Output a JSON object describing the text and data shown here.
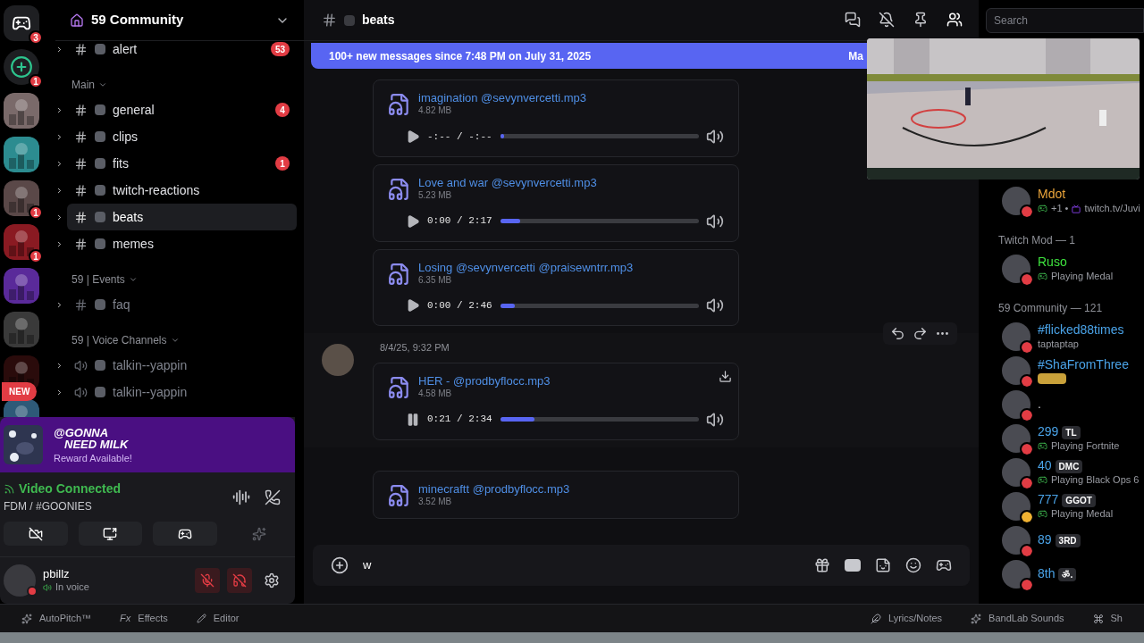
{
  "servers": [
    {
      "kind": "home",
      "badge": "3"
    },
    {
      "kind": "add",
      "badge": "1"
    },
    {
      "kind": "picture"
    },
    {
      "kind": "picture"
    },
    {
      "kind": "picture",
      "badge": "1"
    },
    {
      "kind": "picture",
      "badge": "1"
    },
    {
      "kind": "picture"
    },
    {
      "kind": "picture"
    },
    {
      "kind": "picture"
    },
    {
      "kind": "picture"
    }
  ],
  "new_pill": "NEW",
  "guild": {
    "name": "59 Community"
  },
  "channels": [
    {
      "kind": "text",
      "name": "alert",
      "badge": "53",
      "selected": false,
      "muted": false
    },
    {
      "kind": "category",
      "name": "Main"
    },
    {
      "kind": "text",
      "name": "general",
      "badge": "4",
      "selected": false,
      "muted": false
    },
    {
      "kind": "text",
      "name": "clips",
      "selected": false,
      "muted": false
    },
    {
      "kind": "text",
      "name": "fits",
      "badge": "1",
      "selected": false,
      "muted": false
    },
    {
      "kind": "text",
      "name": "twitch-reactions",
      "selected": false,
      "muted": false
    },
    {
      "kind": "text",
      "name": "beats",
      "selected": true,
      "muted": false
    },
    {
      "kind": "text",
      "name": "memes",
      "selected": false,
      "muted": false
    },
    {
      "kind": "category",
      "name": "59 | Events"
    },
    {
      "kind": "text",
      "name": "faq",
      "selected": false,
      "muted": true
    },
    {
      "kind": "category",
      "name": "59 | Voice Channels"
    },
    {
      "kind": "voice",
      "name": "talkin--yappin",
      "selected": false,
      "muted": true
    },
    {
      "kind": "voice",
      "name": "talkin--yappin",
      "selected": false,
      "muted": true
    }
  ],
  "promo": {
    "handle_1": "@GONNA",
    "handle_2": "NEED MILK",
    "subtitle": "Reward Available!"
  },
  "voice": {
    "status": "Video Connected",
    "channel": "FDM / #GOONIES"
  },
  "user": {
    "name": "pbillz",
    "status": "In voice"
  },
  "chat": {
    "channel": "beats",
    "search_placeholder": "Search",
    "banner": "100+ new messages since 7:48 PM on July 31, 2025",
    "banner_action": "Ma",
    "composer_value": "w"
  },
  "messages": [
    {
      "kind": "attachments",
      "files": [
        {
          "name": "imagination @sevynvercetti.mp3",
          "size": "4.82 MB",
          "time": "-:-- / -:--",
          "level": 0.02,
          "playing": false
        },
        {
          "name": "Love and war @sevynvercetti.mp3",
          "size": "5.23 MB",
          "time": "0:00 / 2:17",
          "level": 0.1,
          "playing": false
        },
        {
          "name": "Losing @sevynvercetti @praisewntrr.mp3",
          "size": "6.35 MB",
          "time": "0:00 / 2:46",
          "level": 0.07,
          "playing": false
        }
      ]
    },
    {
      "kind": "message",
      "timestamp": "8/4/25, 9:32 PM",
      "files": [
        {
          "name": "HER - @prodbyflocc.mp3",
          "size": "4.58 MB",
          "time": "0:21 / 2:34",
          "level": 0.17,
          "playing": true
        }
      ]
    },
    {
      "kind": "attachments",
      "files": [
        {
          "name": "minecraftt @prodbyflocc.mp3",
          "size": "3.52 MB"
        }
      ]
    }
  ],
  "members": [
    {
      "kind": "member",
      "name": "Mdot",
      "color": "#e8a33a",
      "status": {
        "color": "#e23c44"
      },
      "activity": {
        "kind": "game",
        "text": "+1 •",
        "extra": "twitch.tv/Juvi"
      }
    },
    {
      "kind": "header",
      "text": "Twitch Mod — 1"
    },
    {
      "kind": "member",
      "name": "Ruso",
      "color": "#3ee23e",
      "status": {
        "color": "#e23c44"
      },
      "activity": {
        "kind": "game",
        "text": "Playing Medal"
      }
    },
    {
      "kind": "header",
      "text": "59 Community — 121"
    },
    {
      "kind": "member",
      "name": "#flicked88times",
      "color": "#4aa3e8",
      "status": {
        "color": "#e23c44"
      },
      "activity": {
        "kind": "custom",
        "text": "taptaptap"
      }
    },
    {
      "kind": "member",
      "name": "#ShaFromThree",
      "color": "#4aa3e8",
      "status": {
        "color": "#e23c44"
      },
      "activity": {
        "kind": "emoji"
      }
    },
    {
      "kind": "member",
      "name": ".",
      "status": {
        "color": "#e23c44"
      }
    },
    {
      "kind": "member",
      "name": "299",
      "color": "#4aa3e8",
      "status": {
        "color": "#e23c44"
      },
      "tag": "TL",
      "activity": {
        "kind": "game",
        "text": "Playing Fortnite"
      }
    },
    {
      "kind": "member",
      "name": "40",
      "color": "#4aa3e8",
      "status": {
        "color": "#e23c44"
      },
      "tag": "DMC",
      "activity": {
        "kind": "game",
        "text": "Playing Black Ops 6"
      }
    },
    {
      "kind": "member",
      "name": "777",
      "color": "#4aa3e8",
      "status": {
        "color": "#f0b232"
      },
      "tag": "GGOT",
      "activity": {
        "kind": "game",
        "text": "Playing Medal"
      }
    },
    {
      "kind": "member",
      "name": "89",
      "color": "#4aa3e8",
      "status": {
        "color": "#e23c44"
      },
      "tag": "3RD"
    },
    {
      "kind": "member",
      "name": "8th",
      "color": "#4aa3e8",
      "status": {
        "color": "#e23c44"
      },
      "tag": "ॐ."
    }
  ],
  "bottom_bar": {
    "left": [
      {
        "kind": "autopitch",
        "label": "AutoPitch™"
      },
      {
        "kind": "fx",
        "label": "Effects",
        "prefix": "Fx"
      },
      {
        "kind": "editor",
        "label": "Editor"
      }
    ],
    "right": [
      {
        "kind": "lyrics",
        "label": "Lyrics/Notes"
      },
      {
        "kind": "sounds",
        "label": "BandLab Sounds"
      },
      {
        "kind": "shortcut",
        "label": "Sh"
      }
    ]
  }
}
